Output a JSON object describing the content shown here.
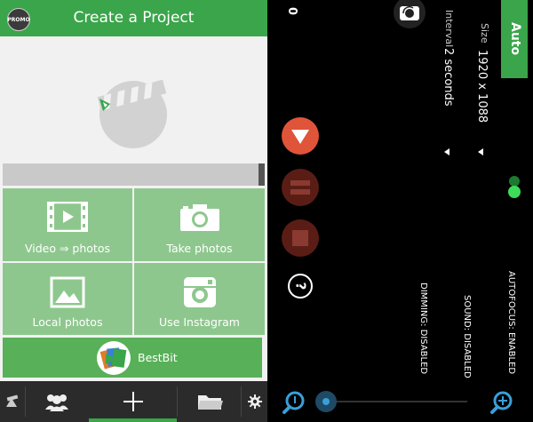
{
  "left": {
    "promo_badge": "PROMO",
    "title": "Create a Project",
    "tiles": [
      {
        "label": "Video ⇒ photos",
        "icon": "film-icon"
      },
      {
        "label": "Take photos",
        "icon": "camera-icon"
      },
      {
        "label": "Local photos",
        "icon": "image-icon"
      },
      {
        "label": "Use Instagram",
        "icon": "instagram-icon"
      }
    ],
    "bestbit_label": "BestBit",
    "bottom_nav": [
      "projects-icon",
      "people-icon",
      "plus-icon",
      "folder-icon",
      "gear-icon"
    ]
  },
  "right": {
    "auto_label": "Auto",
    "size_label": "Size",
    "size_value": "1920 x 1088",
    "interval_label": "Interval",
    "interval_value": "2 seconds",
    "counter": "0",
    "autofocus": "AUTOFOCUS: ENABLED",
    "sound": "SOUND: DISABLED",
    "dimming": "DIMMING: DISABLED",
    "help_glyph": "?"
  },
  "colors": {
    "brand_green": "#3aa54a",
    "tile_green": "#8ec78e",
    "record_red": "#e0543a",
    "dark_red": "#5a1d16",
    "accent_blue": "#3a9fd8"
  }
}
